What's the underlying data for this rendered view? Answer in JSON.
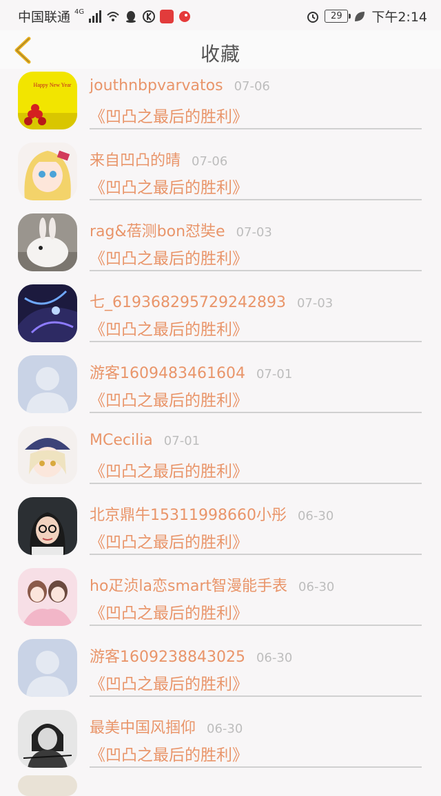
{
  "status_bar": {
    "carrier": "中国联通",
    "network": "4G",
    "battery": "29",
    "time": "下午2:14"
  },
  "header": {
    "title": "收藏",
    "back_icon": "chevron-left-icon"
  },
  "colors": {
    "accent": "#e9956a",
    "back": "#e7b020",
    "date": "#bdbdbd",
    "divider": "#d0d0d0"
  },
  "favorites": [
    {
      "name": "jouthnbpvarvatos",
      "date": "07-06",
      "work": "《凹凸之最后的胜利》",
      "avatar": "new-year-avatar"
    },
    {
      "name": "来自凹凸的晴",
      "date": "07-06",
      "work": "《凹凸之最后的胜利》",
      "avatar": "anime-girl-avatar"
    },
    {
      "name": "rag&蓓测bon怼奘e",
      "date": "07-03",
      "work": "《凹凸之最后的胜利》",
      "avatar": "rabbit-avatar"
    },
    {
      "name": "七_619368295729242893",
      "date": "07-03",
      "work": "《凹凸之最后的胜利》",
      "avatar": "dragon-avatar"
    },
    {
      "name": "游客1609483461604",
      "date": "07-01",
      "work": "《凹凸之最后的胜利》",
      "avatar": "default-person-avatar"
    },
    {
      "name": "MCecilia",
      "date": "07-01",
      "work": "《凹凸之最后的胜利》",
      "avatar": "anime-wizard-avatar"
    },
    {
      "name": "北京鼎牛15311998660小彤",
      "date": "06-30",
      "work": "《凹凸之最后的胜利》",
      "avatar": "woman-glasses-avatar"
    },
    {
      "name": "ho疋浈la恋smart智漫能手表",
      "date": "06-30",
      "work": "《凹凸之最后的胜利》",
      "avatar": "anime-pair-avatar"
    },
    {
      "name": "游客1609238843025",
      "date": "06-30",
      "work": "《凹凸之最后的胜利》",
      "avatar": "default-person-avatar"
    },
    {
      "name": "最美中国风掴仰",
      "date": "06-30",
      "work": "《凹凸之最后的胜利》",
      "avatar": "bw-girl-avatar"
    }
  ]
}
